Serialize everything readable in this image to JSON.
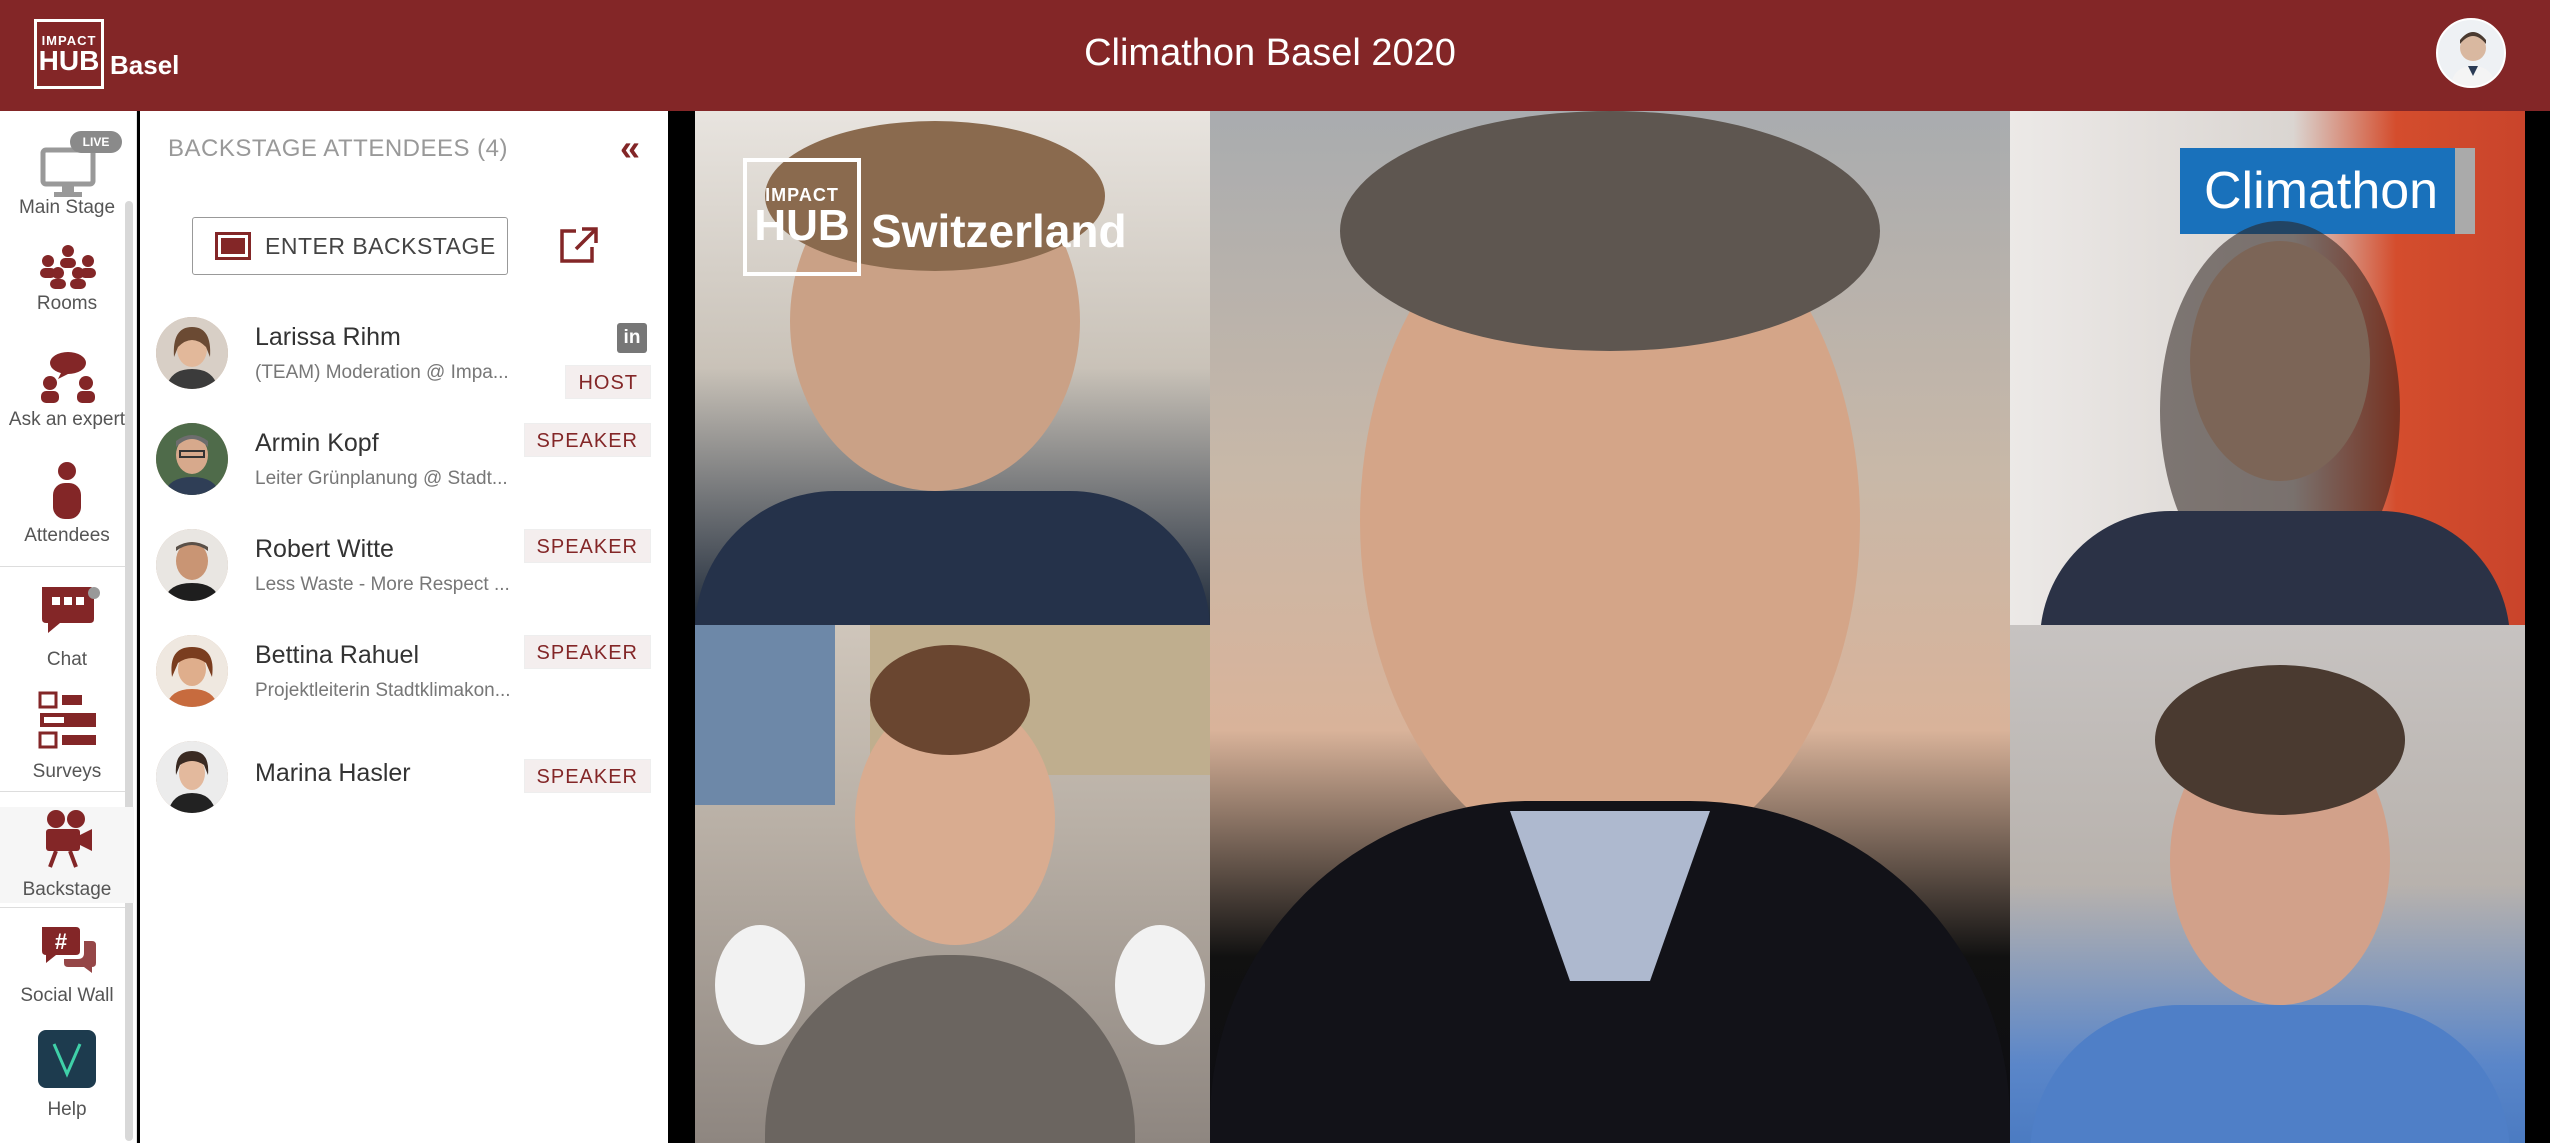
{
  "header": {
    "logo_small": "IMPACT",
    "logo_big": "HUB",
    "logo_city": "Basel",
    "title": "Climathon Basel 2020"
  },
  "nav": {
    "live_badge": "LIVE",
    "items": [
      {
        "label": "Main Stage",
        "icon": "monitor-icon"
      },
      {
        "label": "Rooms",
        "icon": "rooms-icon"
      },
      {
        "label": "Ask an expert",
        "icon": "ask-expert-icon"
      },
      {
        "label": "Attendees",
        "icon": "person-icon"
      },
      {
        "label": "Chat",
        "icon": "chat-icon"
      },
      {
        "label": "Surveys",
        "icon": "surveys-icon"
      },
      {
        "label": "Backstage",
        "icon": "camera-icon"
      },
      {
        "label": "Social Wall",
        "icon": "hashtag-chat-icon"
      },
      {
        "label": "Help",
        "icon": "help-icon",
        "letter": "V"
      }
    ]
  },
  "panel": {
    "title": "BACKSTAGE ATTENDEES (4)",
    "collapse_glyph": "«",
    "enter_label": "ENTER BACKSTAGE",
    "attendees": [
      {
        "name": "Larissa Rihm",
        "subtitle": "(TEAM) Moderation @ Impa...",
        "badge": "HOST",
        "linkedin": "in"
      },
      {
        "name": "Armin Kopf",
        "subtitle": "Leiter Grünplanung @ Stadt...",
        "badge": "SPEAKER"
      },
      {
        "name": "Robert Witte",
        "subtitle": "Less Waste - More Respect ...",
        "badge": "SPEAKER"
      },
      {
        "name": "Bettina Rahuel",
        "subtitle": "Projektleiterin Stadtklimakon...",
        "badge": "SPEAKER"
      },
      {
        "name": "Marina Hasler",
        "subtitle": "",
        "badge": "SPEAKER"
      }
    ]
  },
  "videos": {
    "overlay_small": "IMPACT",
    "overlay_big": "HUB",
    "overlay_word": "Switzerland",
    "climathon_banner": "Climathon"
  },
  "colors": {
    "brand": "#832627",
    "climathon_blue": "#1971bb"
  }
}
